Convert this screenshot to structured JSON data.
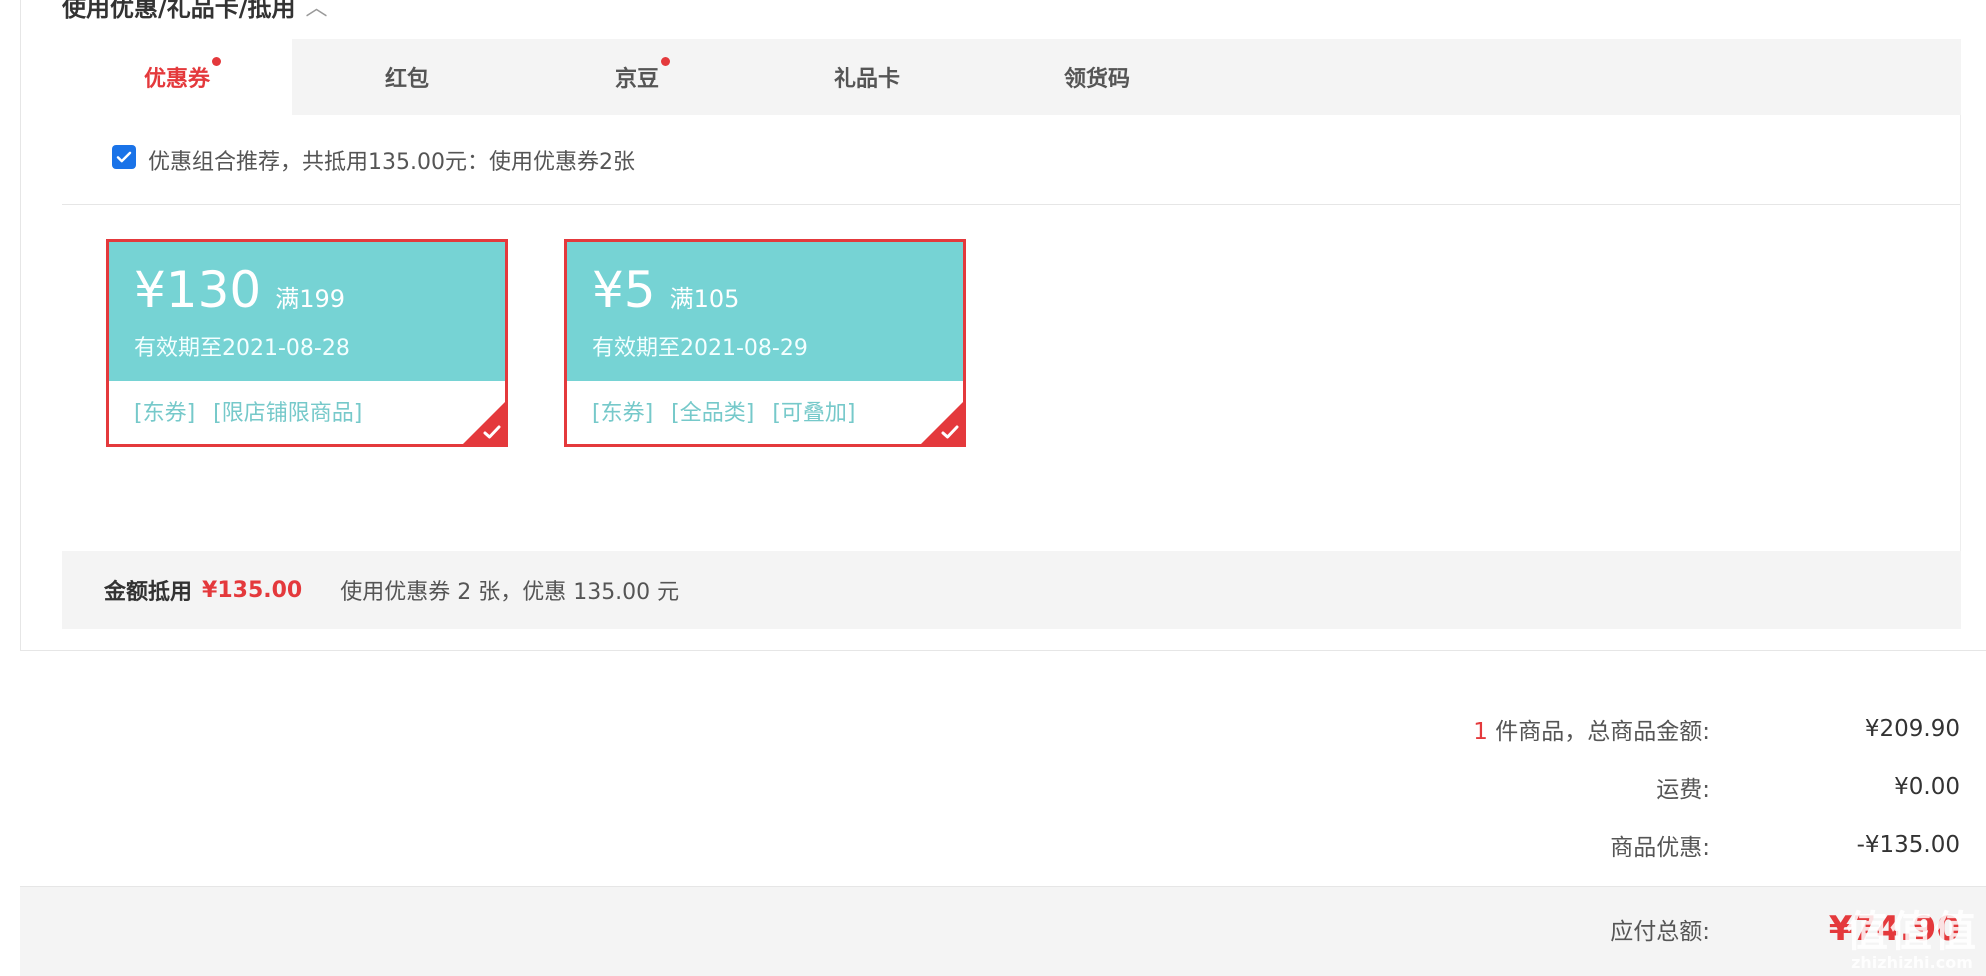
{
  "section": {
    "title": "使用优惠/礼品卡/抵用"
  },
  "tabs": [
    {
      "label": "优惠券",
      "active": true,
      "dot": true
    },
    {
      "label": "红包",
      "active": false,
      "dot": false
    },
    {
      "label": "京豆",
      "active": false,
      "dot": true
    },
    {
      "label": "礼品卡",
      "active": false,
      "dot": false
    },
    {
      "label": "领货码",
      "active": false,
      "dot": false
    }
  ],
  "recommend": {
    "checked": true,
    "text": "优惠组合推荐，共抵用135.00元：使用优惠券2张"
  },
  "coupons": [
    {
      "amount": "¥130",
      "condition": "满199",
      "expiry": "有效期至2021-08-28",
      "tags": [
        "[东券]",
        "[限店铺限商品]"
      ],
      "selected": true
    },
    {
      "amount": "¥5",
      "condition": "满105",
      "expiry": "有效期至2021-08-29",
      "tags": [
        "[东券]",
        "[全品类]",
        "[可叠加]"
      ],
      "selected": true
    }
  ],
  "summary": {
    "label": "金额抵用",
    "value": "¥135.00",
    "desc": "使用优惠券 2 张，优惠 135.00 元"
  },
  "totals": {
    "item_count": "1",
    "items_label": "件商品，总商品金额:",
    "items_value": "¥209.90",
    "shipping_label": "运费:",
    "shipping_value": "¥0.00",
    "discount_label": "商品优惠:",
    "discount_value": "-¥135.00",
    "payable_label": "应付总额:",
    "payable_value": "¥74.90"
  },
  "watermark": {
    "main": "值值值",
    "sub": "zhizhizhi.com"
  },
  "colors": {
    "accent": "#e4393c",
    "coupon": "#76d3d4",
    "bar": "#f4f4f4",
    "checkbox": "#1a73e8"
  },
  "icons": {
    "collapse": "chevron-up-icon",
    "check": "check-icon",
    "corner": "selected-check-icon"
  }
}
